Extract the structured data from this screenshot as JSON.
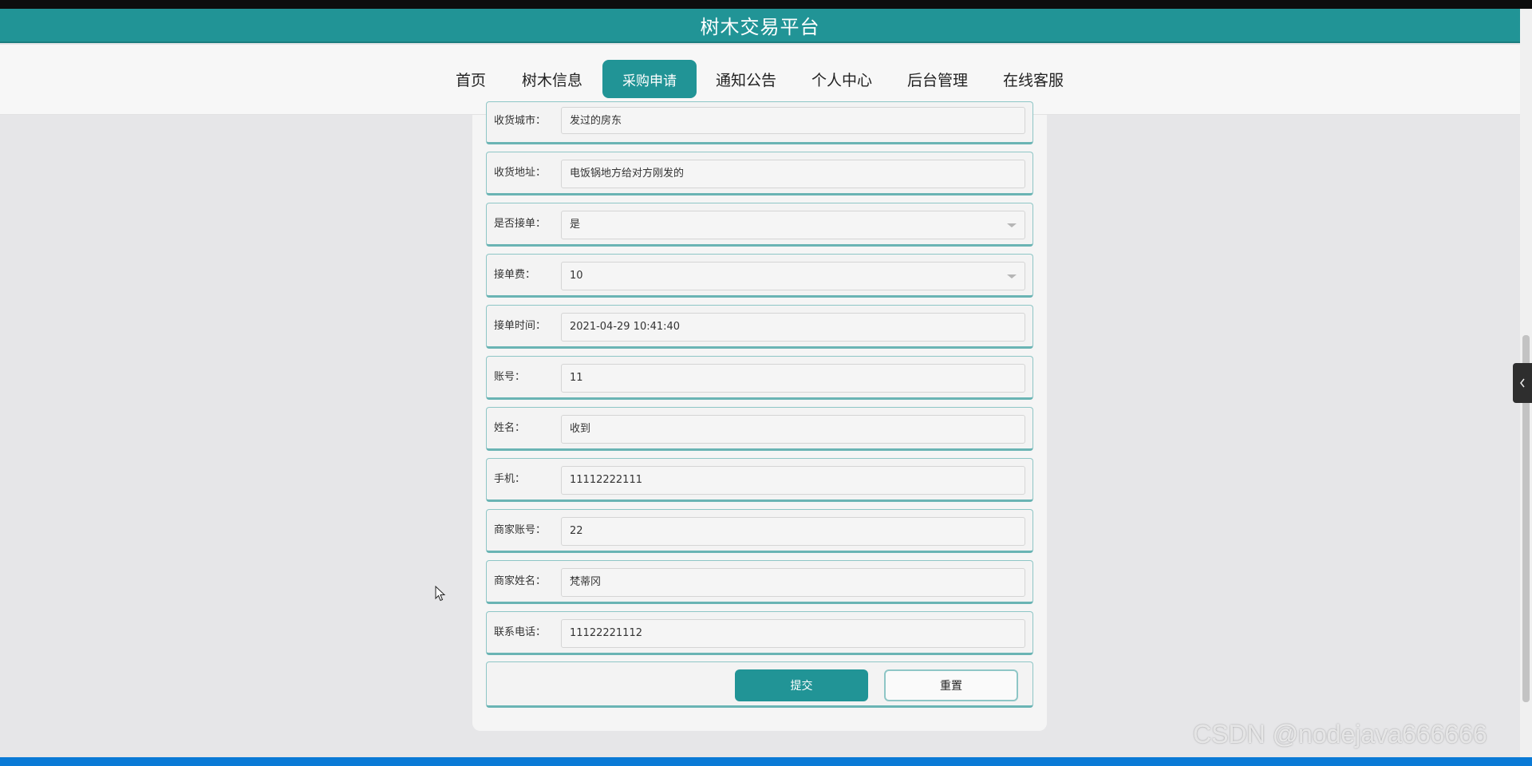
{
  "app": {
    "title": "树木交易平台"
  },
  "nav": {
    "items": [
      {
        "label": "首页"
      },
      {
        "label": "树木信息"
      },
      {
        "label": "采购申请",
        "active": true
      },
      {
        "label": "通知公告"
      },
      {
        "label": "个人中心"
      },
      {
        "label": "后台管理"
      },
      {
        "label": "在线客服"
      }
    ]
  },
  "form": {
    "fields": [
      {
        "label": "收货城市：",
        "value": "发过的房东",
        "type": "text"
      },
      {
        "label": "收货地址：",
        "value": "电饭锅地方给对方刚发的",
        "type": "text"
      },
      {
        "label": "是否接单：",
        "value": "是",
        "type": "select"
      },
      {
        "label": "接单费：",
        "value": "10",
        "type": "select"
      },
      {
        "label": "接单时间：",
        "value": "2021-04-29 10:41:40",
        "type": "text"
      },
      {
        "label": "账号：",
        "value": "11",
        "type": "text"
      },
      {
        "label": "姓名：",
        "value": "收到",
        "type": "text"
      },
      {
        "label": "手机：",
        "value": "11112222111",
        "type": "text"
      },
      {
        "label": "商家账号：",
        "value": "22",
        "type": "text"
      },
      {
        "label": "商家姓名：",
        "value": "梵蒂冈",
        "type": "text"
      },
      {
        "label": "联系电话：",
        "value": "11122221112",
        "type": "text"
      }
    ],
    "submit_label": "提交",
    "reset_label": "重置"
  },
  "watermark": "CSDN @nodejava666666",
  "side_toggle_icon": "chevron-left-icon",
  "colors": {
    "accent": "#219496",
    "row_border": "#8ec6c6"
  }
}
